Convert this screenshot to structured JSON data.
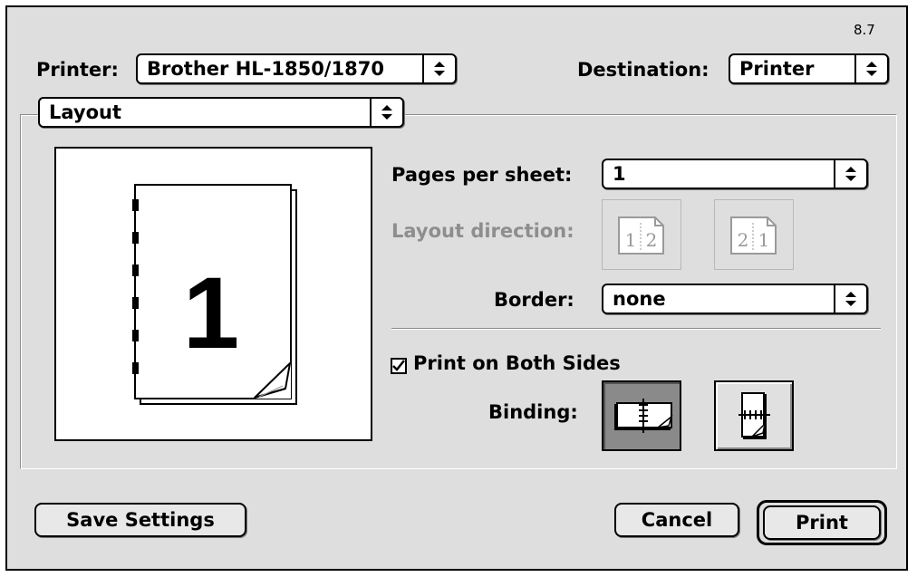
{
  "version": "8.7",
  "printer": {
    "label": "Printer:",
    "value": "Brother HL-1850/1870"
  },
  "destination": {
    "label": "Destination:",
    "value": "Printer"
  },
  "panel_menu": {
    "value": "Layout"
  },
  "preview": {
    "page_number": "1"
  },
  "pages_per_sheet": {
    "label": "Pages per sheet:",
    "value": "1"
  },
  "layout_direction": {
    "label": "Layout direction:",
    "left_to_right": [
      "1",
      "2"
    ],
    "right_to_left": [
      "2",
      "1"
    ]
  },
  "border": {
    "label": "Border:",
    "value": "none"
  },
  "duplex": {
    "label": "Print on Both Sides",
    "checked": true
  },
  "binding": {
    "label": "Binding:"
  },
  "buttons": {
    "save": "Save Settings",
    "cancel": "Cancel",
    "print": "Print"
  }
}
